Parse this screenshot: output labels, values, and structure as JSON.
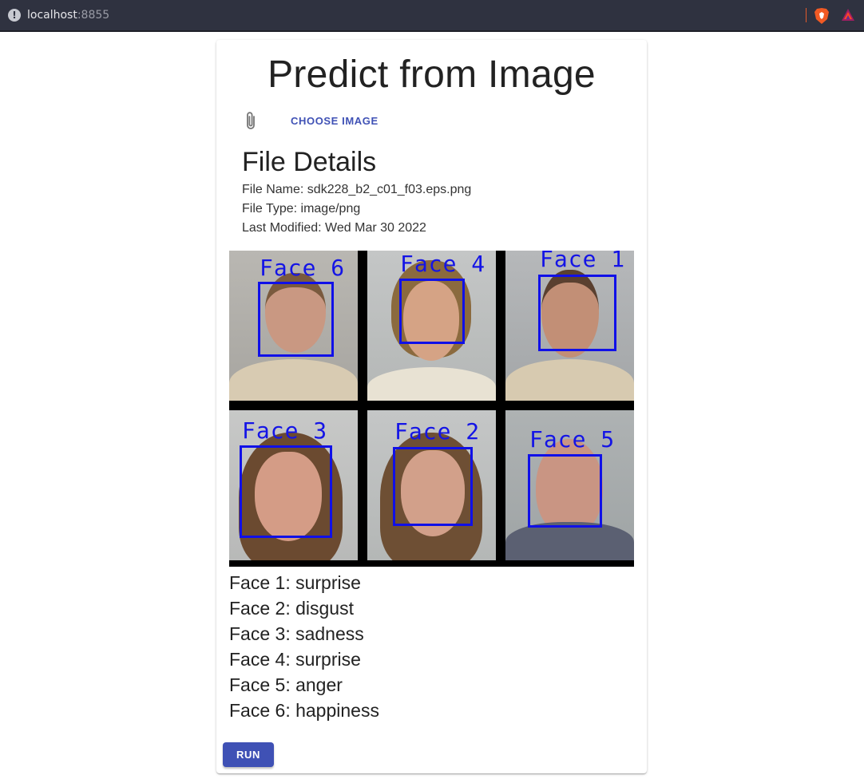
{
  "browser": {
    "host": "localhost",
    "port": ":8855"
  },
  "page": {
    "title": "Predict from Image",
    "choose_label": "CHOOSE IMAGE",
    "details_title": "File Details",
    "file_name": "File Name: sdk228_b2_c01_f03.eps.png",
    "file_type": "File Type: image/png",
    "last_modified": "Last Modified: Wed Mar 30 2022",
    "run_label": "RUN"
  },
  "image_faces": [
    {
      "label": "Face 6"
    },
    {
      "label": "Face 4"
    },
    {
      "label": "Face 1"
    },
    {
      "label": "Face 3"
    },
    {
      "label": "Face 2"
    },
    {
      "label": "Face 5"
    }
  ],
  "results": [
    "Face 1: surprise",
    "Face 2: disgust",
    "Face 3: sadness",
    "Face 4: surprise",
    "Face 5: anger",
    "Face 6: happiness"
  ],
  "colors": {
    "accent": "#3f51b5",
    "box": "#1010e8"
  },
  "icons": {
    "info": "info-icon",
    "attach": "paperclip-icon",
    "brave": "brave-shield-icon",
    "rewards": "brave-rewards-icon"
  }
}
